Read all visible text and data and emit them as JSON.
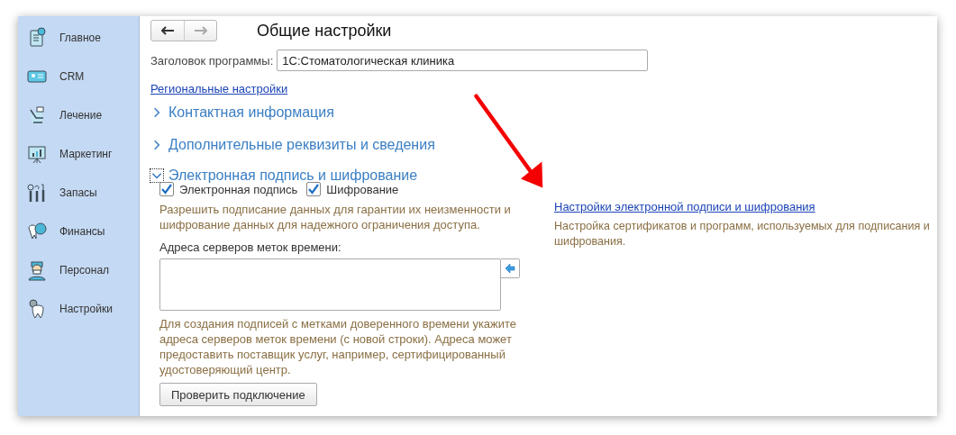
{
  "sidebar": {
    "items": [
      {
        "label": "Главное"
      },
      {
        "label": "CRM"
      },
      {
        "label": "Лечение"
      },
      {
        "label": "Маркетинг"
      },
      {
        "label": "Запасы"
      },
      {
        "label": "Финансы"
      },
      {
        "label": "Персонал"
      },
      {
        "label": "Настройки"
      }
    ]
  },
  "page": {
    "title": "Общие настройки",
    "app_title_label": "Заголовок программы:",
    "app_title_value": "1С:Стоматологическая клиника",
    "regional_link": "Региональные настройки"
  },
  "groups": [
    {
      "title": "Контактная информация",
      "expanded": false
    },
    {
      "title": "Дополнительные реквизиты и сведения",
      "expanded": false
    },
    {
      "title": "Электронная подпись и шифрование",
      "expanded": true
    }
  ],
  "signature": {
    "checkboxes": [
      {
        "label": "Электронная подпись",
        "checked": true
      },
      {
        "label": "Шифрование",
        "checked": true
      }
    ],
    "description": "Разрешить подписание данных для гарантии их неизменности и шифрование данных для надежного ограничения доступа.",
    "servers_label": "Адреса серверов меток времени:",
    "servers_hint": "Для создания подписей с метками доверенного времени укажите адреса серверов меток времени (с новой строки). Адреса может предоставить поставщик услуг, например, сертифицированный удостоверяющий центр.",
    "check_button": "Проверить подключение",
    "settings_link": "Настройки электронной подписи и шифрования",
    "settings_description": "Настройка сертификатов и программ, используемых для подписания и шифрования."
  }
}
